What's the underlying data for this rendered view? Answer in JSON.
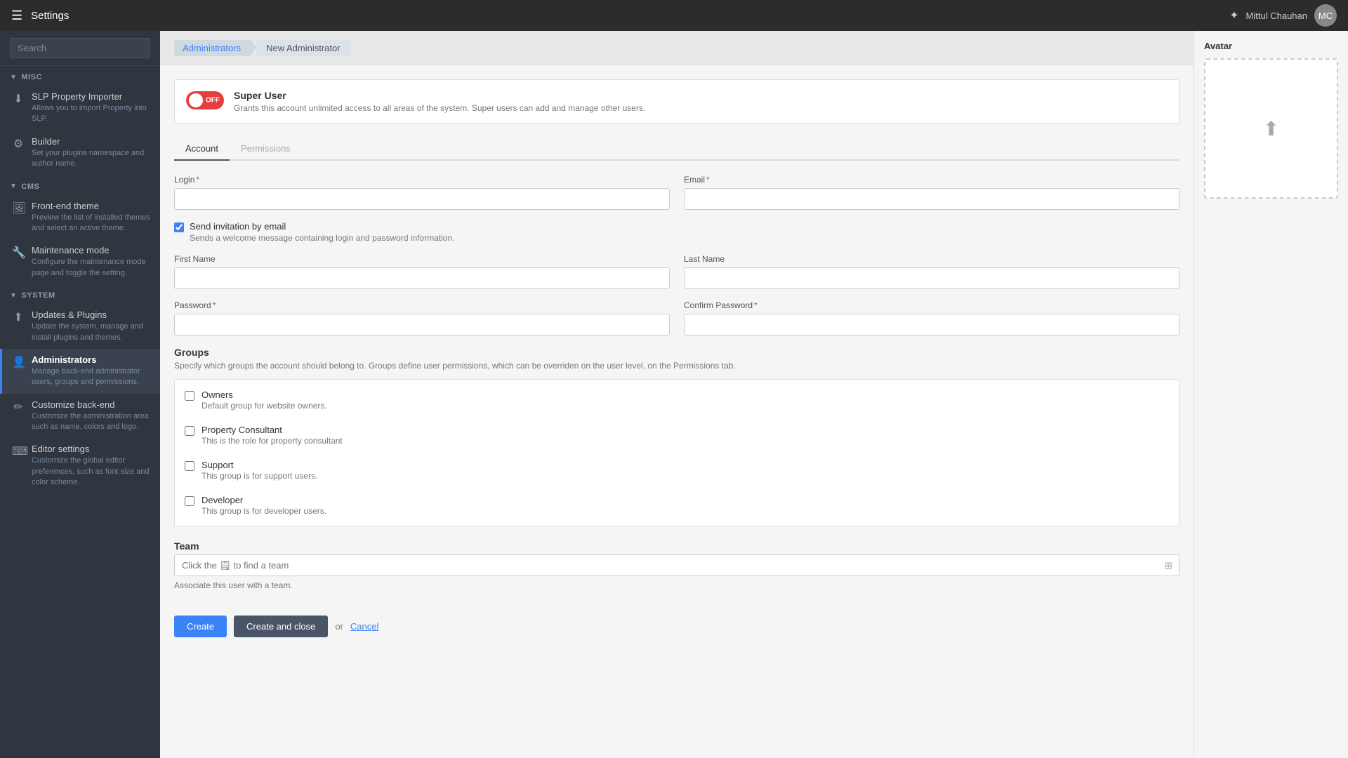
{
  "topbar": {
    "app_title": "Settings",
    "username": "Mittul Chauhan",
    "hamburger_icon": "☰",
    "star_icon": "✦",
    "avatar_initials": "MC"
  },
  "sidebar": {
    "search_placeholder": "Search",
    "sections": [
      {
        "id": "misc",
        "label": "MISC",
        "items": [
          {
            "id": "slp-property-importer",
            "icon": "⬇",
            "title": "SLP Property Importer",
            "desc": "Allows you to import Property into SLP.",
            "active": false
          },
          {
            "id": "builder",
            "icon": "⚙",
            "title": "Builder",
            "desc": "Set your plugins namespace and author name.",
            "active": false
          }
        ]
      },
      {
        "id": "cms",
        "label": "CMS",
        "items": [
          {
            "id": "front-end-theme",
            "icon": "🖼",
            "title": "Front-end theme",
            "desc": "Preview the list of installed themes and select an active theme.",
            "active": false
          },
          {
            "id": "maintenance-mode",
            "icon": "🔧",
            "title": "Maintenance mode",
            "desc": "Configure the maintenance mode page and toggle the setting.",
            "active": false
          }
        ]
      },
      {
        "id": "system",
        "label": "SYSTEM",
        "items": [
          {
            "id": "updates-plugins",
            "icon": "⬆",
            "title": "Updates & Plugins",
            "desc": "Update the system, manage and install plugins and themes.",
            "active": false
          },
          {
            "id": "administrators",
            "icon": "👤",
            "title": "Administrators",
            "desc": "Manage back-end administrator users, groups and permissions.",
            "active": true
          },
          {
            "id": "customize-back-end",
            "icon": "✏",
            "title": "Customize back-end",
            "desc": "Customize the administration area such as name, colors and logo.",
            "active": false
          },
          {
            "id": "editor-settings",
            "icon": "⌨",
            "title": "Editor settings",
            "desc": "Customize the global editor preferences, such as font size and color scheme.",
            "active": false
          }
        ]
      }
    ]
  },
  "breadcrumb": {
    "parent": "Administrators",
    "current": "New Administrator"
  },
  "super_user": {
    "toggle_label": "OFF",
    "title": "Super User",
    "desc": "Grants this account unlimited access to all areas of the system. Super users can add and manage other users."
  },
  "tabs": [
    {
      "id": "account",
      "label": "Account",
      "active": true
    },
    {
      "id": "permissions",
      "label": "Permissions",
      "active": false
    }
  ],
  "form": {
    "login_label": "Login",
    "email_label": "Email",
    "send_invitation_label": "Send invitation by email",
    "send_invitation_desc": "Sends a welcome message containing login and password information.",
    "first_name_label": "First Name",
    "last_name_label": "Last Name",
    "password_label": "Password",
    "confirm_password_label": "Confirm Password",
    "groups_title": "Groups",
    "groups_desc": "Specify which groups the account should belong to. Groups define user permissions, which can be overriden on the user level, on the Permissions tab.",
    "groups": [
      {
        "id": "owners",
        "name": "Owners",
        "desc": "Default group for website owners."
      },
      {
        "id": "property-consultant",
        "name": "Property Consultant",
        "desc": "This is the role for property consultant"
      },
      {
        "id": "support",
        "name": "Support",
        "desc": "This group is for support users."
      },
      {
        "id": "developer",
        "name": "Developer",
        "desc": "This group is for developer users."
      }
    ],
    "team_title": "Team",
    "team_placeholder": "Click the 🗒 to find a team",
    "team_desc": "Associate this user with a team."
  },
  "buttons": {
    "create": "Create",
    "create_and_close": "Create and close",
    "or_text": "or",
    "cancel": "Cancel"
  },
  "avatar": {
    "title": "Avatar",
    "upload_icon": "⬆"
  }
}
